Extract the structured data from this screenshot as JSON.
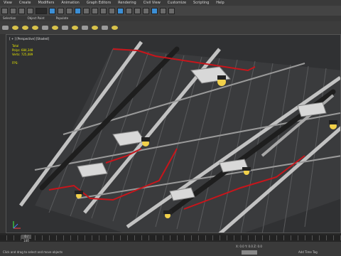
{
  "menu": [
    "View",
    "Create",
    "Modifiers",
    "Animation",
    "Graph Editors",
    "Rendering",
    "Civil View",
    "Customize",
    "Scripting",
    "Help"
  ],
  "toolbar": {
    "selection_filter": "All"
  },
  "ribbon": [
    "Selection",
    "Object Paint",
    "Populate"
  ],
  "viewport": {
    "label": "[ + ] [Perspective] [Shaded]",
    "stats": {
      "total_label": "Total",
      "polys_label": "Polys:",
      "polys": "684,348",
      "verts_label": "Verts:",
      "verts": "725,089",
      "fps": "FPS:"
    }
  },
  "timeline": {
    "frame": "0 / 100"
  },
  "status": {
    "line1": "",
    "line2": "Click and drag to select and move objects",
    "coords": "X: 0.0 Y: 0.0 Z: 0.0",
    "tag": "Add Time Tag"
  },
  "colors": {
    "accent": "#3c8fd6",
    "beams": "#bdbdbd",
    "red_lines": "#c8151b",
    "light": "#f2d14a"
  }
}
